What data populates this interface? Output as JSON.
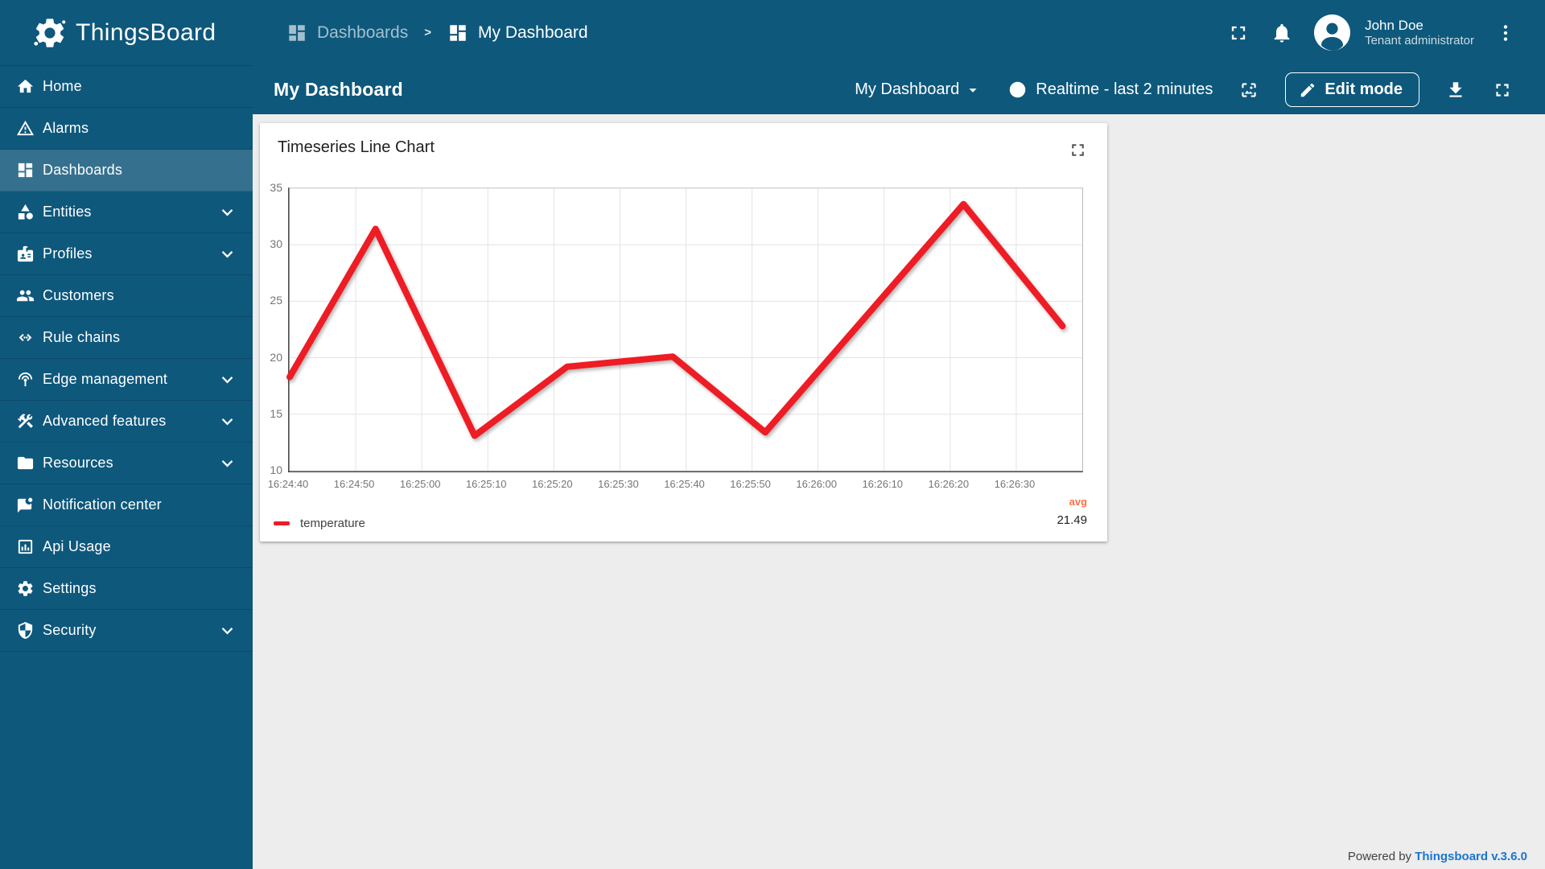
{
  "app": {
    "name": "ThingsBoard"
  },
  "colors": {
    "primary": "#0e587c",
    "primary_selected": "#35718f",
    "line_red": "#ee1c24",
    "avg_orange": "#ff7043",
    "link_blue": "#1976d2"
  },
  "topbar": {
    "breadcrumb": [
      {
        "label": "Dashboards",
        "icon": "dashboards"
      },
      {
        "label": "My Dashboard",
        "icon": "dashboards"
      }
    ],
    "icons": [
      "fullscreen",
      "notifications",
      "more-vert"
    ],
    "user": {
      "name": "John Doe",
      "role": "Tenant administrator"
    }
  },
  "toolbar": {
    "page_title": "My Dashboard",
    "dashboard_select": {
      "value": "My Dashboard"
    },
    "time_window": "Realtime - last 2 minutes",
    "edit_button_label": "Edit mode",
    "icons": [
      "image",
      "edit-pencil",
      "download",
      "fullscreen"
    ]
  },
  "sidebar": {
    "items": [
      {
        "label": "Home",
        "icon": "home",
        "selected": false,
        "expandable": false
      },
      {
        "label": "Alarms",
        "icon": "alarms",
        "selected": false,
        "expandable": false
      },
      {
        "label": "Dashboards",
        "icon": "dashboards",
        "selected": true,
        "expandable": false
      },
      {
        "label": "Entities",
        "icon": "entities",
        "selected": false,
        "expandable": true
      },
      {
        "label": "Profiles",
        "icon": "profiles",
        "selected": false,
        "expandable": true
      },
      {
        "label": "Customers",
        "icon": "customers",
        "selected": false,
        "expandable": false
      },
      {
        "label": "Rule chains",
        "icon": "rule-chains",
        "selected": false,
        "expandable": false
      },
      {
        "label": "Edge management",
        "icon": "edge-management",
        "selected": false,
        "expandable": true
      },
      {
        "label": "Advanced features",
        "icon": "advanced-features",
        "selected": false,
        "expandable": true
      },
      {
        "label": "Resources",
        "icon": "resources",
        "selected": false,
        "expandable": true
      },
      {
        "label": "Notification center",
        "icon": "notification-center",
        "selected": false,
        "expandable": false
      },
      {
        "label": "Api Usage",
        "icon": "api-usage",
        "selected": false,
        "expandable": false
      },
      {
        "label": "Settings",
        "icon": "settings",
        "selected": false,
        "expandable": false
      },
      {
        "label": "Security",
        "icon": "security",
        "selected": false,
        "expandable": true
      }
    ]
  },
  "widget": {
    "title": "Timeseries Line Chart"
  },
  "chart_data": {
    "type": "line",
    "title": "Timeseries Line Chart",
    "x_ticks": [
      "16:24:40",
      "16:24:50",
      "16:25:00",
      "16:25:10",
      "16:25:20",
      "16:25:30",
      "16:25:40",
      "16:25:50",
      "16:26:00",
      "16:26:10",
      "16:26:20",
      "16:26:30"
    ],
    "y_ticks": [
      35,
      30,
      25,
      20,
      15,
      10
    ],
    "ylim": [
      10,
      35
    ],
    "x_window_seconds": 120,
    "grid": true,
    "legend_position": "bottom",
    "series": [
      {
        "name": "temperature",
        "color": "#ee1c24",
        "points": [
          {
            "t": "16:24:40",
            "v": 18.3
          },
          {
            "t": "16:24:53",
            "v": 31.4
          },
          {
            "t": "16:25:08",
            "v": 13.1
          },
          {
            "t": "16:25:22",
            "v": 19.2
          },
          {
            "t": "16:25:38",
            "v": 20.1
          },
          {
            "t": "16:25:52",
            "v": 13.4
          },
          {
            "t": "16:26:22",
            "v": 33.6
          },
          {
            "t": "16:26:37",
            "v": 22.8
          }
        ]
      }
    ],
    "aggregation": {
      "label": "avg",
      "value": "21.49"
    }
  },
  "footer": {
    "powered_by": "Powered by ",
    "version_link": "Thingsboard v.3.6.0"
  }
}
